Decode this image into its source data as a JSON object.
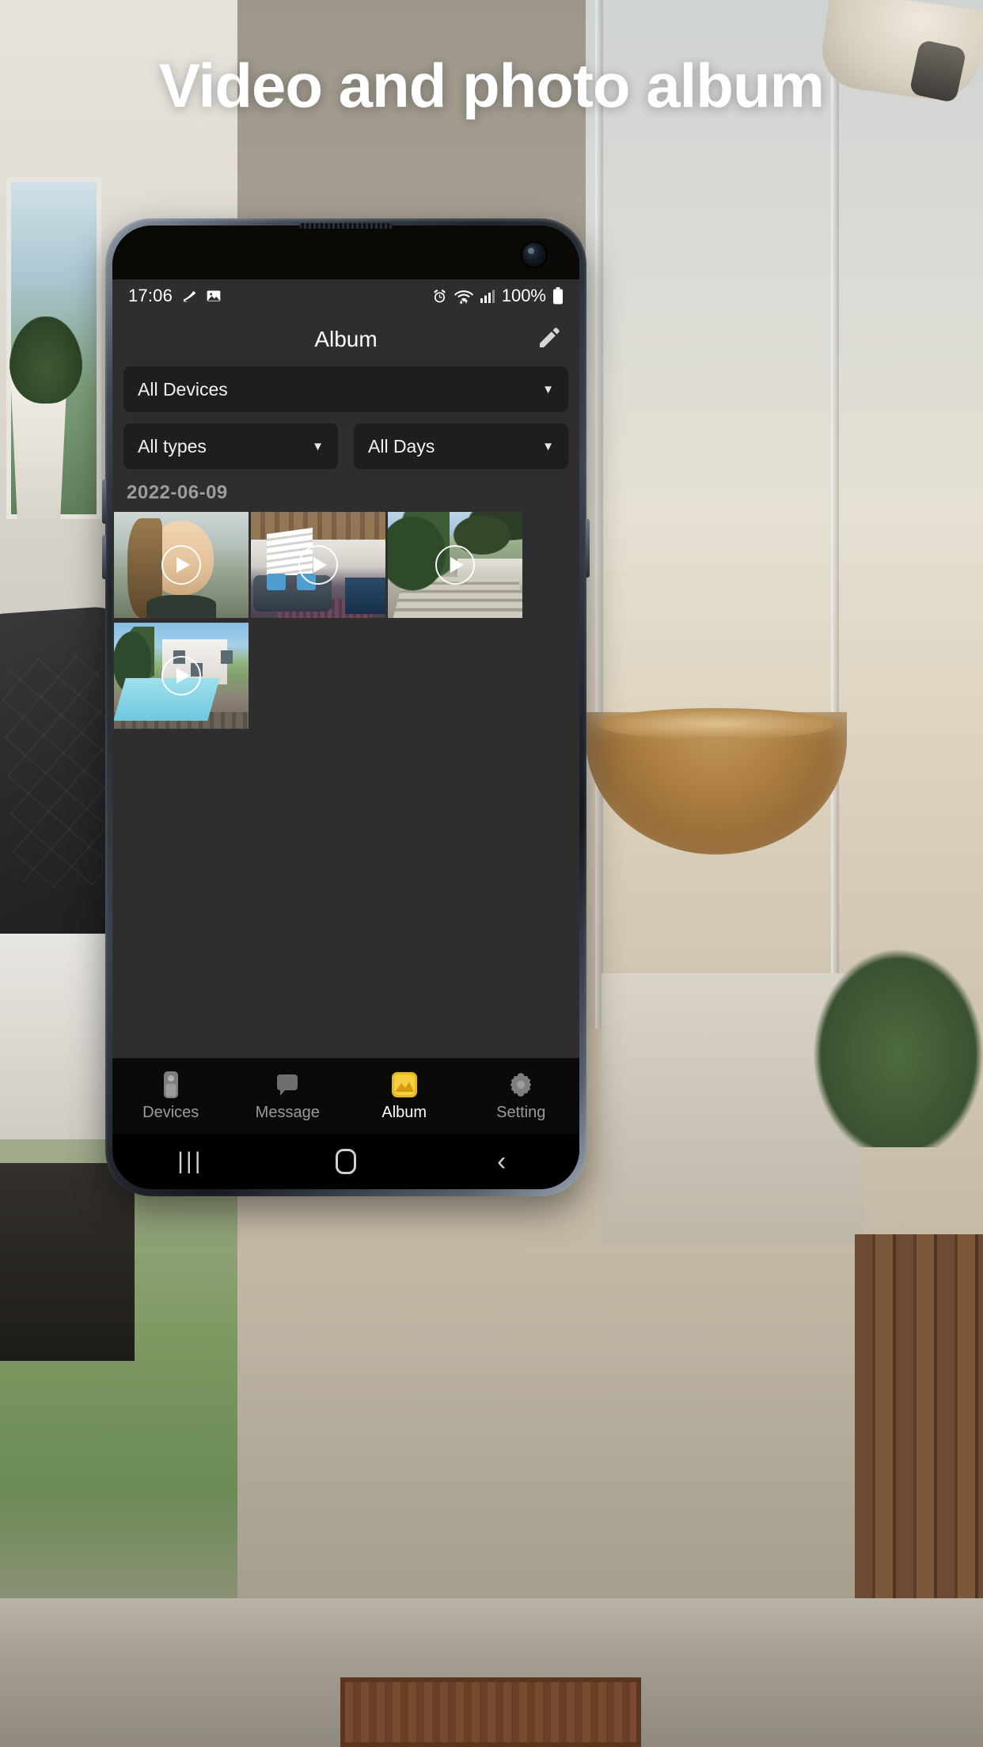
{
  "headline": "Video and photo album",
  "phone": {
    "status_bar": {
      "time": "17:06",
      "left_icons": [
        "do-not-disturb-icon",
        "image-icon"
      ],
      "right_icons": [
        "alarm-icon",
        "wifi-icon",
        "signal-icon"
      ],
      "battery_percent": "100%",
      "battery_icon": "battery-full-icon"
    },
    "app_bar": {
      "title": "Album",
      "edit_icon": "pencil-icon"
    },
    "filters": {
      "device": {
        "label": "All Devices",
        "caret": "chevron-down-icon"
      },
      "type": {
        "label": "All types",
        "caret": "chevron-down-icon"
      },
      "day": {
        "label": "All Days",
        "caret": "chevron-down-icon"
      }
    },
    "album": {
      "date_group": "2022-06-09",
      "items": [
        {
          "name": "video-thumbnail-portrait",
          "overlay": "play-icon"
        },
        {
          "name": "video-thumbnail-interior",
          "overlay": "play-icon"
        },
        {
          "name": "video-thumbnail-driveway",
          "overlay": "play-icon"
        },
        {
          "name": "video-thumbnail-pool",
          "overlay": "play-icon"
        }
      ]
    },
    "tabs": [
      {
        "label": "Devices",
        "icon": "camera-device-icon",
        "active": false
      },
      {
        "label": "Message",
        "icon": "message-bubble-icon",
        "active": false
      },
      {
        "label": "Album",
        "icon": "gallery-icon",
        "active": true
      },
      {
        "label": "Setting",
        "icon": "gear-icon",
        "active": false
      }
    ],
    "nav_bar": {
      "recents": "recents-icon",
      "home": "home-icon",
      "back": "back-icon"
    }
  },
  "colors": {
    "accent": "#e8b820",
    "app_bg": "#2e2e2e",
    "field_bg": "#1e1e1e",
    "tabbar_bg": "#0a0a0a",
    "text_primary": "#ffffff",
    "text_muted": "#9d9d9d"
  }
}
